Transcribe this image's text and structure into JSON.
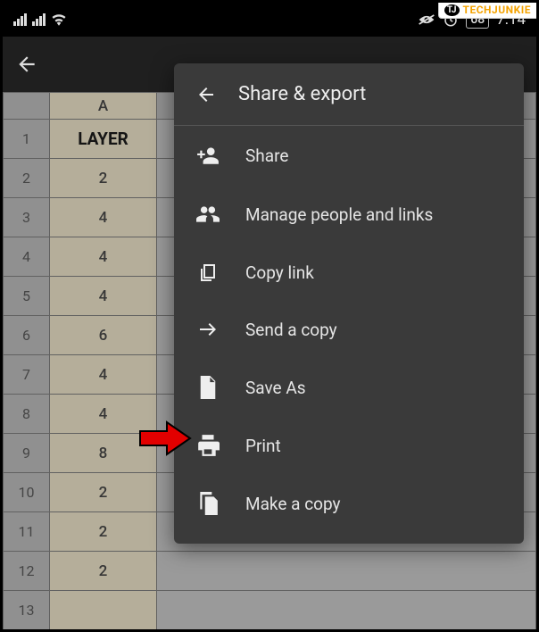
{
  "statusbar": {
    "battery": "68",
    "time": "7:14"
  },
  "menu": {
    "title": "Share & export",
    "items": [
      {
        "label": "Share",
        "icon": "person-add-icon"
      },
      {
        "label": "Manage people and links",
        "icon": "people-icon"
      },
      {
        "label": "Copy link",
        "icon": "copy-link-icon"
      },
      {
        "label": "Send a copy",
        "icon": "send-icon"
      },
      {
        "label": "Save As",
        "icon": "file-icon"
      },
      {
        "label": "Print",
        "icon": "print-icon"
      },
      {
        "label": "Make a copy",
        "icon": "duplicate-icon"
      }
    ]
  },
  "sheet": {
    "col_header": "A",
    "header_cell": "LAYER",
    "rows": [
      {
        "n": "1"
      },
      {
        "n": "2",
        "v": "2"
      },
      {
        "n": "3",
        "v": "4"
      },
      {
        "n": "4",
        "v": "4"
      },
      {
        "n": "5",
        "v": "4"
      },
      {
        "n": "6",
        "v": "6"
      },
      {
        "n": "7",
        "v": "4"
      },
      {
        "n": "8",
        "v": "4"
      },
      {
        "n": "9",
        "v": "8"
      },
      {
        "n": "10",
        "v": "2"
      },
      {
        "n": "11",
        "v": "2"
      },
      {
        "n": "12",
        "v": "2"
      },
      {
        "n": "13",
        "v": ""
      }
    ]
  },
  "watermark": {
    "badge": "TJ",
    "text": "TECHJUNKIE"
  }
}
